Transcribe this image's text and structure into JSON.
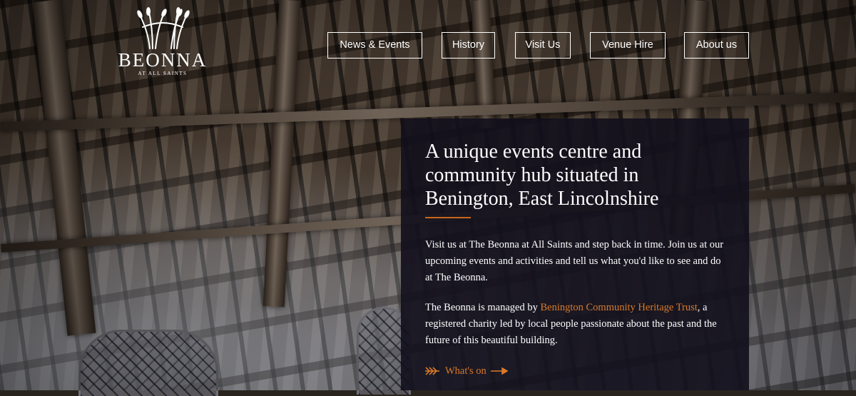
{
  "brand": {
    "name": "BEONNA",
    "subtitle": "AT ALL SAINTS"
  },
  "nav": [
    {
      "label": "News & Events"
    },
    {
      "label": "History"
    },
    {
      "label": "Visit Us"
    },
    {
      "label": "Venue Hire"
    },
    {
      "label": "About us"
    }
  ],
  "hero": {
    "headline": "A unique events centre and community hub situated in Benington, East Lincolnshire",
    "para1": "Visit us at The Beonna at All Saints and step back in time. Join us at our upcoming events and activities and tell us what you'd like to see and do at The Beonna.",
    "para2_before": "The Beonna is managed by ",
    "para2_link": "Benington Community Heritage Trust",
    "para2_after": ", a registered charity led by local people passionate about the past and the future of this beautiful building.",
    "cta_label": "What's on"
  },
  "colors": {
    "accent": "#d9792a",
    "panel": "#12101c",
    "text": "#ffffff"
  },
  "icons": {
    "logo": "wheat-sheaf-icon",
    "cta_left": "double-chevron-right-icon",
    "cta_right": "arrow-right-icon"
  }
}
